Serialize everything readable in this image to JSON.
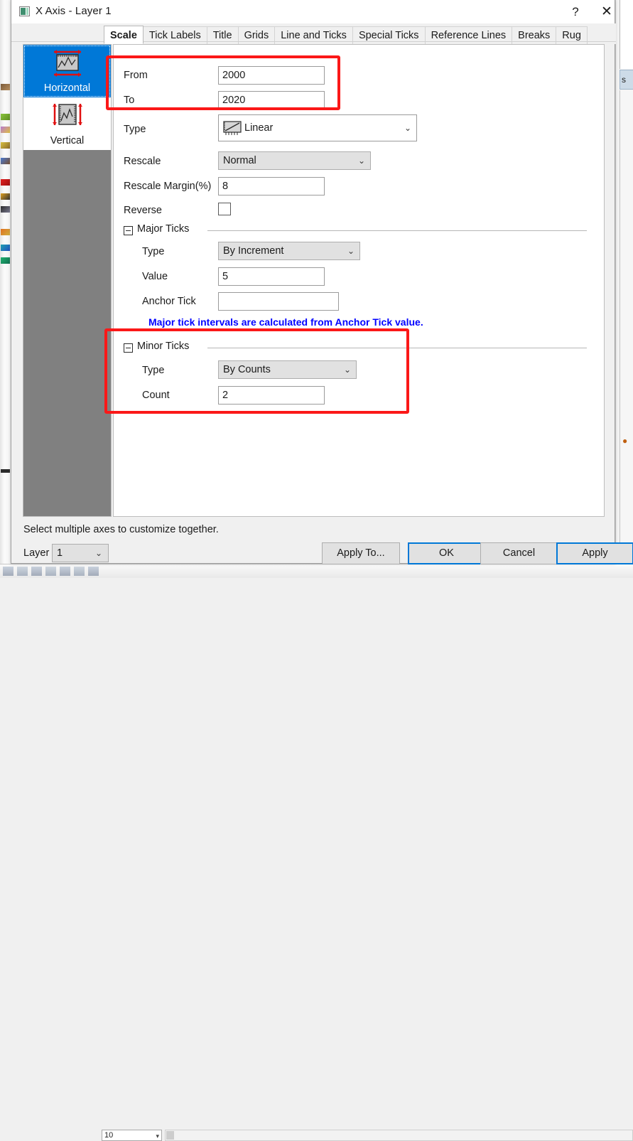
{
  "window": {
    "title": "X Axis - Layer 1",
    "icon": "axis-dialog-icon",
    "help_label": "?",
    "close_label": "✕"
  },
  "tabs": [
    {
      "label": "Scale",
      "active": true
    },
    {
      "label": "Tick Labels",
      "active": false
    },
    {
      "label": "Title",
      "active": false
    },
    {
      "label": "Grids",
      "active": false
    },
    {
      "label": "Line and Ticks",
      "active": false
    },
    {
      "label": "Special Ticks",
      "active": false
    },
    {
      "label": "Reference Lines",
      "active": false
    },
    {
      "label": "Breaks",
      "active": false
    },
    {
      "label": "Rug",
      "active": false
    }
  ],
  "axis_list": [
    {
      "label": "Horizontal",
      "icon": "horizontal-axis-icon",
      "selected": true
    },
    {
      "label": "Vertical",
      "icon": "vertical-axis-icon",
      "selected": false
    }
  ],
  "scale": {
    "from_label": "From",
    "from_value": "2000",
    "to_label": "To",
    "to_value": "2020",
    "type_label": "Type",
    "type_value": "Linear",
    "type_icon": "linear-scale-icon",
    "rescale_label": "Rescale",
    "rescale_value": "Normal",
    "rescale_margin_label": "Rescale Margin(%)",
    "rescale_margin_value": "8",
    "reverse_label": "Reverse",
    "reverse_checked": false
  },
  "major_ticks": {
    "group_label": "Major Ticks",
    "type_label": "Type",
    "type_value": "By Increment",
    "value_label": "Value",
    "value_value": "5",
    "anchor_label": "Anchor Tick",
    "anchor_value": "",
    "hint": "Major tick intervals are calculated from Anchor Tick value."
  },
  "minor_ticks": {
    "group_label": "Minor Ticks",
    "type_label": "Type",
    "type_value": "By Counts",
    "count_label": "Count",
    "count_value": "2"
  },
  "footer": {
    "status": "Select multiple axes to customize together.",
    "layer_label": "Layer",
    "layer_value": "1",
    "apply_to": "Apply To...",
    "ok": "OK",
    "cancel": "Cancel",
    "apply": "Apply"
  },
  "background": {
    "right_tab_label": "s",
    "bottom_zoom_value": "10"
  },
  "colors": {
    "accent": "#0078d7",
    "annotation": "#fb1818",
    "hint": "#0000ff",
    "filler": "#808080"
  }
}
